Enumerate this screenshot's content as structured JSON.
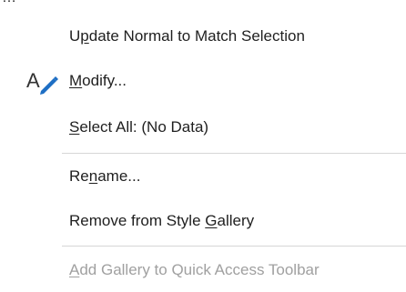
{
  "background_row": {
    "text": "…"
  },
  "menu": {
    "items": [
      {
        "pre": "U",
        "ul": "p",
        "post": "date Normal to Match Selection",
        "label": "Update Normal to Match Selection",
        "enabled": true,
        "icon": null
      },
      {
        "pre": "",
        "ul": "M",
        "post": "odify...",
        "label": "Modify...",
        "enabled": true,
        "icon": "style-format-icon"
      },
      {
        "pre": "",
        "ul": "S",
        "post": "elect All: (No Data)",
        "label": "Select All: (No Data)",
        "enabled": true,
        "icon": null
      },
      {
        "pre": "Re",
        "ul": "n",
        "post": "ame...",
        "label": "Rename...",
        "enabled": true,
        "icon": null
      },
      {
        "pre": "Remove from Style ",
        "ul": "G",
        "post": "allery",
        "label": "Remove from Style Gallery",
        "enabled": true,
        "icon": null
      },
      {
        "pre": "",
        "ul": "A",
        "post": "dd Gallery to Quick Access Toolbar",
        "label": "Add Gallery to Quick Access Toolbar",
        "enabled": false,
        "icon": null
      }
    ]
  },
  "colors": {
    "text": "#1f1f1f",
    "disabled_text": "#a0a0a0",
    "separator": "#d6d6d6",
    "icon_blue": "#1e6fc4",
    "icon_dark": "#333333"
  }
}
